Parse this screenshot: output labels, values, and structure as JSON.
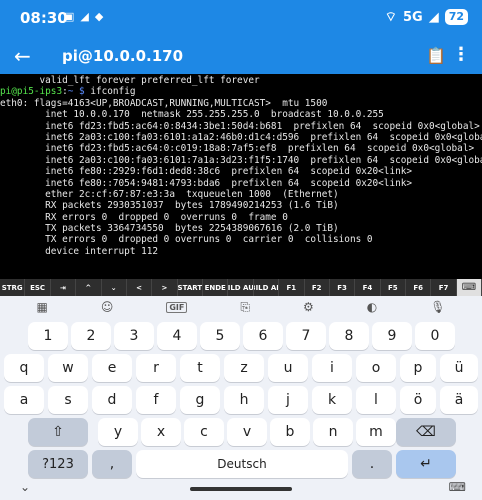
{
  "status_bar": {
    "time": "08:30",
    "left_icons": [
      "terminal-icon",
      "notification-icon",
      "notification-icon"
    ],
    "network": "5G",
    "battery": "72"
  },
  "app_bar": {
    "title": "pi@10.0.0.170"
  },
  "terminal": {
    "lines": [
      "       valid_lft forever preferred_lft forever",
      "",
      " ~ ifconfig",
      "eth0: flags=4163<UP,BROADCAST,RUNNING,MULTICAST>  mtu 1500",
      "        inet 10.0.0.170  netmask 255.255.255.0  broadcast 10.0.0.255",
      "        inet6 fd23:fbd5:ac64:0:8434:3be1:50d4:b681  prefixlen 64  scopeid 0x0<global>",
      "        inet6 2a03:c100:fa03:6101:a1a2:46b0:d1c4:d596  prefixlen 64  scopeid 0x0<global>",
      "        inet6 fd23:fbd5:ac64:0:c019:18a8:7af5:ef8  prefixlen 64  scopeid 0x0<global>",
      "        inet6 2a03:c100:fa03:6101:7a1a:3d23:f1f5:1740  prefixlen 64  scopeid 0x0<global>",
      "        inet6 fe80::2929:f6d1:ded8:38c6  prefixlen 64  scopeid 0x20<link>",
      "        inet6 fe80::7054:9481:4793:bda6  prefixlen 64  scopeid 0x20<link>",
      "        ether 2c:cf:67:87:e3:3a  txqueuelen 1000  (Ethernet)",
      "        RX packets 2930351037  bytes 1789490214253 (1.6 TiB)",
      "        RX errors 0  dropped 0  overruns 0  frame 0",
      "        TX packets 3364734550  bytes 2254389067616 (2.0 TiB)",
      "        TX errors 0  dropped 0 overruns 0  carrier 0  collisions 0",
      "        device interrupt 112"
    ],
    "prompt_user": "pi@pi5-ips3",
    "prompt_sep": ":",
    "prompt_path": "~ $",
    "command": " ifconfig"
  },
  "extra_keys": [
    "STRG",
    "ESC",
    "⇥",
    "^",
    "⌄",
    "<",
    ">",
    "START",
    "ENDE",
    "BILD AUF",
    "BILD AB",
    "F1",
    "F2",
    "F3",
    "F4",
    "F5",
    "F6",
    "F7"
  ],
  "suggestions": {
    "gif": "GIF"
  },
  "keyboard": {
    "numbers": [
      "1",
      "2",
      "3",
      "4",
      "5",
      "6",
      "7",
      "8",
      "9",
      "0"
    ],
    "row1": [
      "q",
      "w",
      "e",
      "r",
      "t",
      "z",
      "u",
      "i",
      "o",
      "p",
      "ü"
    ],
    "row2": [
      "a",
      "s",
      "d",
      "f",
      "g",
      "h",
      "j",
      "k",
      "l",
      "ö",
      "ä"
    ],
    "row3": [
      "y",
      "x",
      "c",
      "v",
      "b",
      "n",
      "m"
    ],
    "symbols_label": "?123",
    "comma": ",",
    "space_label": "Deutsch",
    "period": "."
  },
  "colors": {
    "accent": "#1e88e5",
    "terminal_bg": "#000000",
    "prompt_user": "#55e34c",
    "prompt_path": "#5a8cff",
    "keyboard_bg": "#eef1f7"
  }
}
